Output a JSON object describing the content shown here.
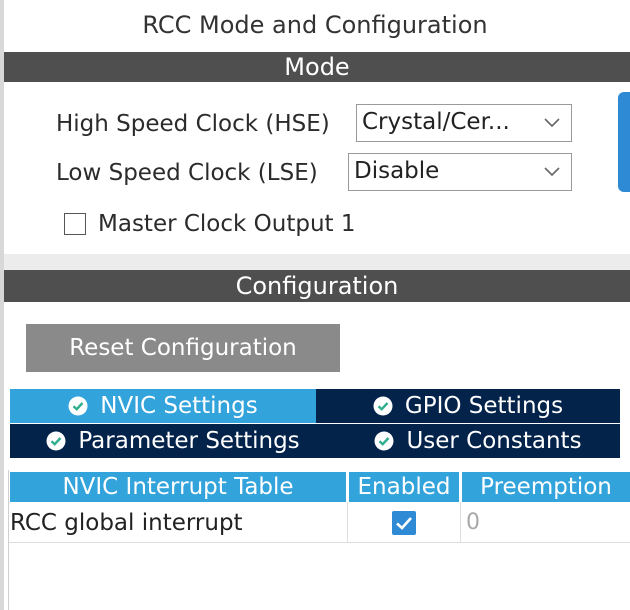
{
  "title": "RCC Mode and Configuration",
  "mode": {
    "section_label": "Mode",
    "hse": {
      "label": "High Speed Clock (HSE)",
      "value": "Crystal/Cer..."
    },
    "lse": {
      "label": "Low Speed Clock (LSE)",
      "value": "Disable"
    },
    "mco1": {
      "label": "Master Clock Output 1",
      "checked": false
    }
  },
  "configuration": {
    "section_label": "Configuration",
    "reset_label": "Reset Configuration",
    "tabs": [
      {
        "label": "NVIC Settings",
        "active": true,
        "icon": "check-circle-icon"
      },
      {
        "label": "GPIO Settings",
        "active": false,
        "icon": "check-circle-icon"
      },
      {
        "label": "Parameter Settings",
        "active": false,
        "icon": "check-circle-icon"
      },
      {
        "label": "User Constants",
        "active": false,
        "icon": "check-circle-icon"
      }
    ],
    "table": {
      "columns": [
        "NVIC Interrupt Table",
        "Enabled",
        "Preemption"
      ],
      "rows": [
        {
          "name": "RCC global interrupt",
          "enabled": true,
          "preemption": "0"
        }
      ]
    }
  },
  "colors": {
    "section_bar": "#4f4f4f",
    "tab_active": "#33a3dc",
    "tab_inactive": "#03234b",
    "checkbox_checked": "#2f8ad6",
    "reset_button": "#8a8a8a"
  }
}
